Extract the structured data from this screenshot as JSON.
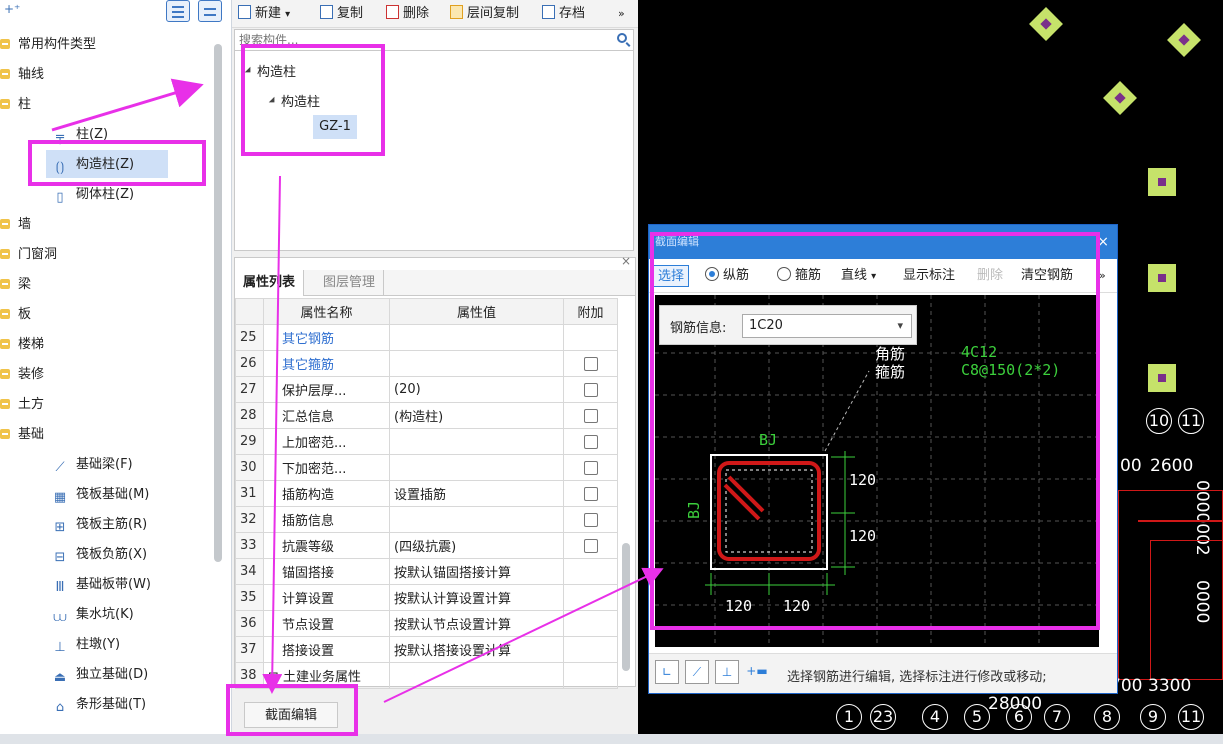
{
  "tree": {
    "items": [
      {
        "label": "常用构件类型"
      },
      {
        "label": "轴线"
      },
      {
        "label": "柱"
      },
      {
        "label": "柱(Z)"
      },
      {
        "label": "构造柱(Z)"
      },
      {
        "label": "砌体柱(Z)"
      },
      {
        "label": "墙"
      },
      {
        "label": "门窗洞"
      },
      {
        "label": "梁"
      },
      {
        "label": "板"
      },
      {
        "label": "楼梯"
      },
      {
        "label": "装修"
      },
      {
        "label": "土方"
      },
      {
        "label": "基础"
      },
      {
        "label": "基础梁(F)"
      },
      {
        "label": "筏板基础(M)"
      },
      {
        "label": "筏板主筋(R)"
      },
      {
        "label": "筏板负筋(X)"
      },
      {
        "label": "基础板带(W)"
      },
      {
        "label": "集水坑(K)"
      },
      {
        "label": "柱墩(Y)"
      },
      {
        "label": "独立基础(D)"
      },
      {
        "label": "条形基础(T)"
      }
    ]
  },
  "toolbar": {
    "new_label": "新建",
    "copy_label": "复制",
    "delete_label": "删除",
    "floor_copy_label": "层间复制",
    "archive_label": "存档",
    "more": "»"
  },
  "search": {
    "placeholder": "搜索构件..."
  },
  "component_tree": {
    "group1": "构造柱",
    "group2": "构造柱",
    "item": "GZ-1"
  },
  "property_panel": {
    "close": "×",
    "tab_properties": "属性列表",
    "tab_layers": "图层管理",
    "col_name": "属性名称",
    "col_value": "属性值",
    "col_extra": "附加",
    "rows": [
      {
        "num": "25",
        "name": "其它钢筋",
        "value": ""
      },
      {
        "num": "26",
        "name": "其它箍筋",
        "value": ""
      },
      {
        "num": "27",
        "name": "保护层厚...",
        "value": "(20)"
      },
      {
        "num": "28",
        "name": "汇总信息",
        "value": "(构造柱)"
      },
      {
        "num": "29",
        "name": "上加密范...",
        "value": ""
      },
      {
        "num": "30",
        "name": "下加密范...",
        "value": ""
      },
      {
        "num": "31",
        "name": "插筋构造",
        "value": "设置插筋"
      },
      {
        "num": "32",
        "name": "插筋信息",
        "value": ""
      },
      {
        "num": "33",
        "name": "抗震等级",
        "value": "(四级抗震)"
      },
      {
        "num": "34",
        "name": "锚固搭接",
        "value": "按默认锚固搭接计算"
      },
      {
        "num": "35",
        "name": "计算设置",
        "value": "按默认计算设置计算"
      },
      {
        "num": "36",
        "name": "节点设置",
        "value": "按默认节点设置计算"
      },
      {
        "num": "37",
        "name": "搭接设置",
        "value": "按默认搭接设置计算"
      },
      {
        "num": "38",
        "name": "土建业务属性",
        "value": ""
      }
    ],
    "section_button": "截面编辑"
  },
  "dialog": {
    "title": "截面编辑",
    "close": "×",
    "select_label": "选择",
    "radio_longitudinal": "纵筋",
    "radio_stirrup": "箍筋",
    "line_label": "直线",
    "show_annotation_label": "显示标注",
    "delete_label": "删除",
    "clear_rebar_label": "清空钢筋",
    "more": "»",
    "rebar_info_label": "钢筋信息:",
    "rebar_info_value": "1C20",
    "label_corner_rebar": "角筋",
    "label_stirrup": "箍筋",
    "value_corner_rebar": "4C12",
    "value_stirrup": "C8@150(2*2)",
    "bj_top": "BJ",
    "bj_left": "BJ",
    "dim_right_1": "120",
    "dim_right_2": "120",
    "dim_bottom_1": "120",
    "dim_bottom_2": "120",
    "hint": "选择钢筋进行编辑, 选择标注进行修改或移动;"
  },
  "canvas": {
    "axis_top_labels": [
      "10",
      "11"
    ],
    "dim_2600": "2600",
    "dim_00": "00",
    "dim_28000": "28000",
    "dim_700": "700",
    "dim_3300": "3300",
    "side_text_1": "0000002",
    "side_text_2": "0000",
    "bottom_axes": [
      "1",
      "23",
      "4",
      "5",
      "6",
      "7",
      "8",
      "9",
      "11"
    ]
  }
}
